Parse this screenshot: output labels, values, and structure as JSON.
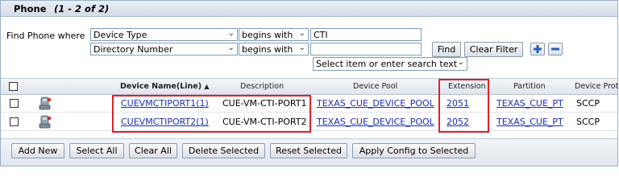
{
  "title": {
    "name": "Phone",
    "count": "(1 - 2 of 2)"
  },
  "find": {
    "label": "Find Phone where",
    "row1": {
      "field": "Device Type",
      "op": "begins with",
      "value": "CTI"
    },
    "row2": {
      "field": "Directory Number",
      "op": "begins with",
      "value": ""
    },
    "find_button": "Find",
    "clear_button": "Clear Filter",
    "search_select": "Select item or enter search text"
  },
  "columns": {
    "device_name": "Device Name(Line)",
    "description": "Description",
    "device_pool": "Device Pool",
    "extension": "Extension",
    "partition": "Partition",
    "protocol": "Device Proto"
  },
  "rows": [
    {
      "device_name": "CUEVMCTIPORT1(1)",
      "description": "CUE-VM-CTI-PORT1",
      "device_pool": "TEXAS_CUE_DEVICE_POOL",
      "extension": "2051",
      "partition": "TEXAS_CUE_PT",
      "protocol": "SCCP"
    },
    {
      "device_name": "CUEVMCTIPORT2(1)",
      "description": "CUE-VM-CTI-PORT2",
      "device_pool": "TEXAS_CUE_DEVICE_POOL",
      "extension": "2052",
      "partition": "TEXAS_CUE_PT",
      "protocol": "SCCP"
    }
  ],
  "actions": {
    "add_new": "Add New",
    "select_all": "Select All",
    "clear_all": "Clear All",
    "delete_selected": "Delete Selected",
    "reset_selected": "Reset Selected",
    "apply_config": "Apply Config to Selected"
  },
  "icons": {
    "sort": "sort-ascending-icon",
    "add": "plus-icon",
    "remove": "minus-icon",
    "device": "cti-port-icon",
    "dropdown": "chevron-down-icon"
  },
  "colors": {
    "link": "#1a2fb8",
    "highlight": "#e0202a",
    "header_bg": "#dfe5ec"
  }
}
